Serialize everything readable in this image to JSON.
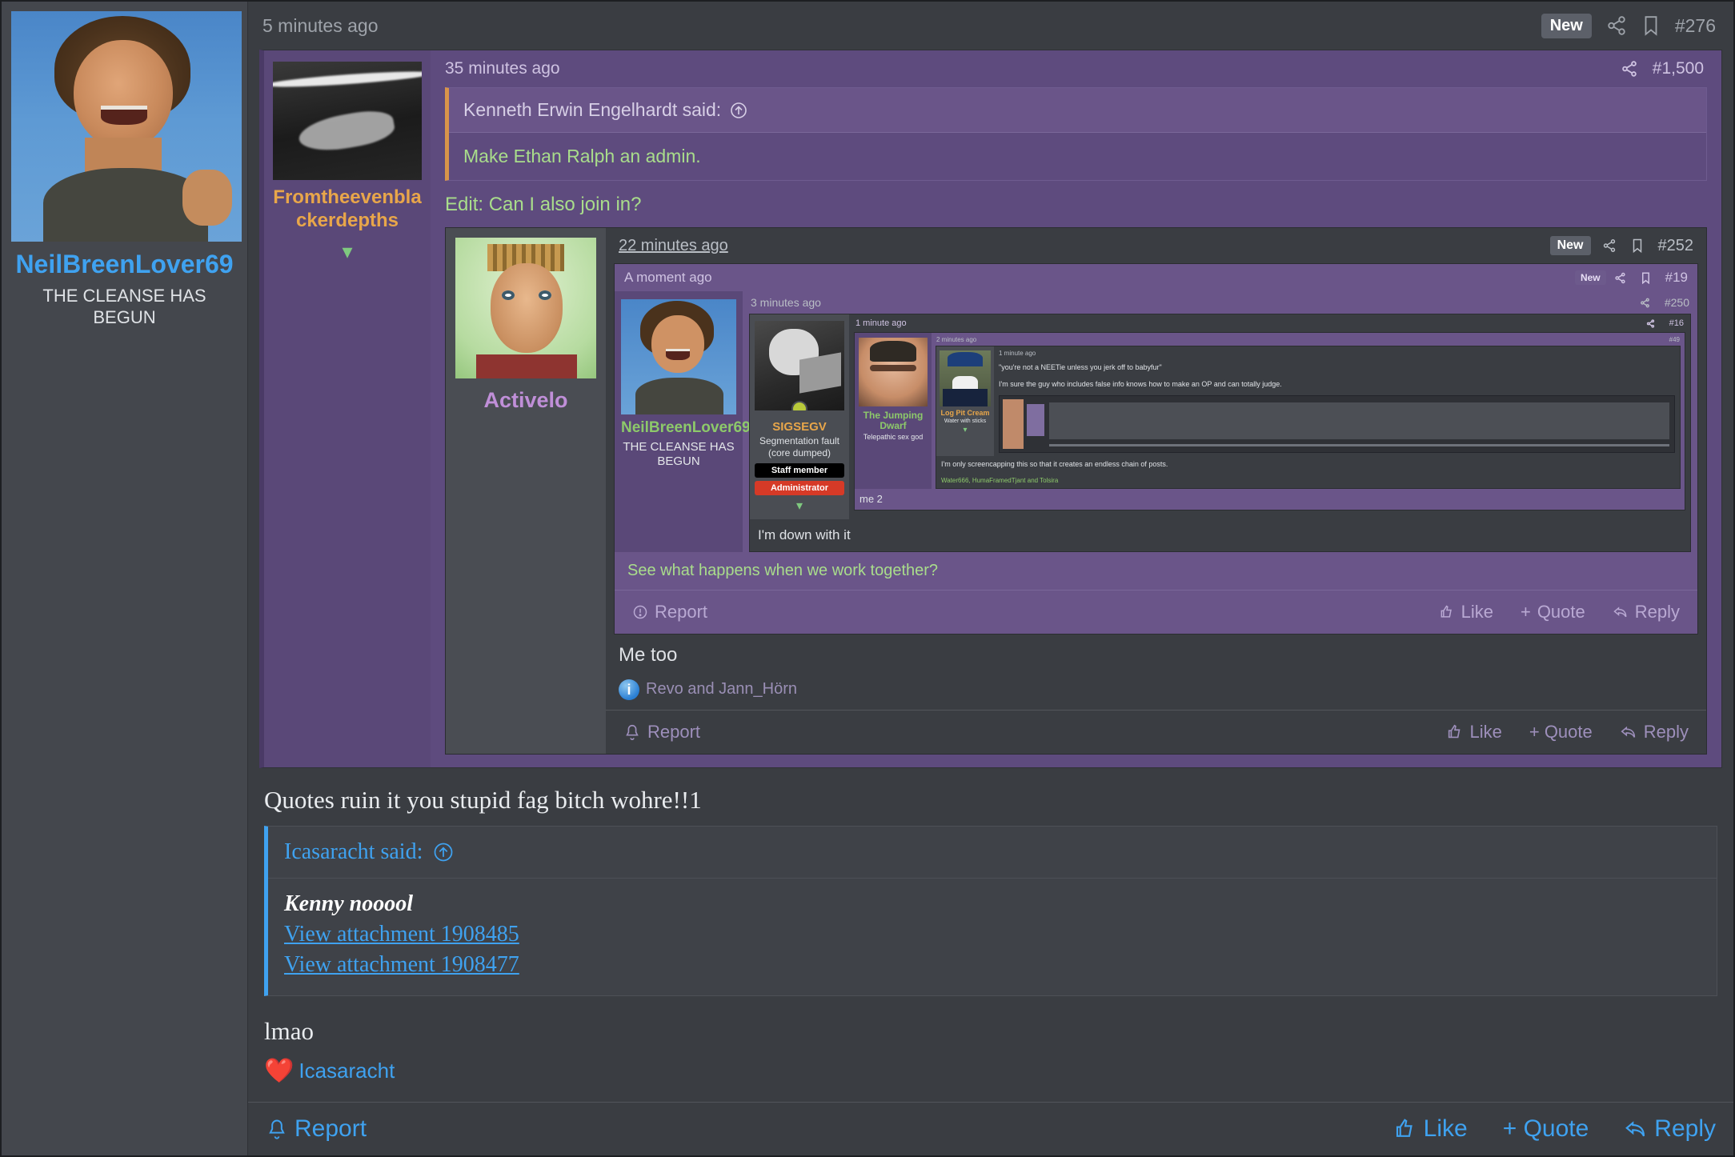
{
  "author": {
    "name": "NeilBreenLover69",
    "title": "THE CLEANSE HAS BEGUN",
    "avatar_alt": "laughing-man-blue-sky"
  },
  "post_header": {
    "timestamp": "5 minutes ago",
    "new_badge": "New",
    "share_icon": "share-icon",
    "bookmark_icon": "bookmark-icon",
    "post_number": "#276"
  },
  "quote_level1": {
    "timestamp": "35 minutes ago",
    "share_icon": "share-icon",
    "post_number": "#1,500",
    "username": "Fromtheevenblackerdepths",
    "expand_icon": "chevron-down-icon",
    "inner_quote": {
      "attribution": "Kenneth Erwin Engelhardt said:",
      "jump_icon": "arrow-up-circle-icon",
      "text": "Make Ethan Ralph an admin."
    },
    "edit_line": "Edit: Can I also join in?"
  },
  "nested_level2": {
    "timestamp": "22 minutes ago",
    "new_badge": "New",
    "share_icon": "share-icon",
    "bookmark_icon": "bookmark-icon",
    "post_number": "#252",
    "username": "Activelo",
    "body_text": "Me too",
    "reaction_icon": "info-reaction",
    "reaction_names": "Revo and Jann_Hörn",
    "actions": {
      "report": "Report",
      "like": "Like",
      "quote": "+ Quote",
      "reply": "Reply"
    }
  },
  "nested_level3": {
    "timestamp": "A moment ago",
    "new_badge": "New",
    "share_icon": "share-icon",
    "bookmark_icon": "bookmark-icon",
    "post_number": "#19",
    "username": "SIGSEGV",
    "user_subtitle": "Segmentation fault (core dumped)",
    "staff_badge": "Staff member",
    "admin_badge": "Administrator",
    "expand_icon": "chevron-down-icon",
    "body_text": "See what happens when we work together?",
    "actions": {
      "report": "Report",
      "like": "Like",
      "quote": "Quote",
      "reply": "Reply"
    }
  },
  "nested_level4": {
    "timestamp": "3 minutes ago",
    "share_icon": "share-icon",
    "post_number": "#250",
    "username": "NeilBreenLover69",
    "user_subtitle": "THE CLEANSE HAS BEGUN",
    "body_text": "I'm down with it"
  },
  "nested_level5": {
    "timestamp": "1 minute ago",
    "share_icon": "share-icon",
    "post_number": "#16",
    "username": "SIGSEGV",
    "user_subtitle": "Segmentation fault (core dumped)",
    "staff_badge": "Staff member",
    "admin_badge": "Administrator",
    "expand_icon": "chevron-down-icon",
    "body_text": "me 2"
  },
  "nested_level6": {
    "timestamp": "2 minutes ago",
    "share_icon": "share-icon",
    "post_number": "#49",
    "username": "The Jumping Dwarf",
    "user_subtitle": "Telepathic sex god",
    "body_text": "I'm only screencapping this so that it creates an endless chain of posts.",
    "reaction_names": "Water666, HumaFramedTjant and Tolsira"
  },
  "nested_level7": {
    "timestamp": "1 minute ago",
    "username": "Log Pit Cream",
    "user_subtitle": "Water with sticks",
    "expand_icon": "chevron-down-icon",
    "quote_text": "\"you're not a NEETie unless you jerk off to babyfur\"",
    "body_text": "I'm sure the guy who includes false info knows how to make an OP and can totally judge."
  },
  "main_post": {
    "text": "Quotes ruin it you stupid fag bitch wohre!!1",
    "quote": {
      "attribution": "Icasaracht said:",
      "jump_icon": "arrow-up-circle-icon",
      "strong_line": "Kenny nooool",
      "attachments": [
        "View attachment 1908485",
        "View attachment 1908477"
      ]
    },
    "closing_text": "lmao",
    "reaction_icon": "heart-icon",
    "reaction_name": "Icasaracht",
    "actions": {
      "report": "Report",
      "like": "Like",
      "quote": "+ Quote",
      "reply": "Reply"
    }
  },
  "colors": {
    "page_bg": "#3a3d42",
    "purple": "#5e4b7e",
    "link": "#3fa2f0",
    "username_orange": "#e8a64a",
    "username_green": "#8dc96a",
    "username_purple": "#c08fd8",
    "admin_red": "#d63a27",
    "quote_green": "#a9dd8b"
  }
}
